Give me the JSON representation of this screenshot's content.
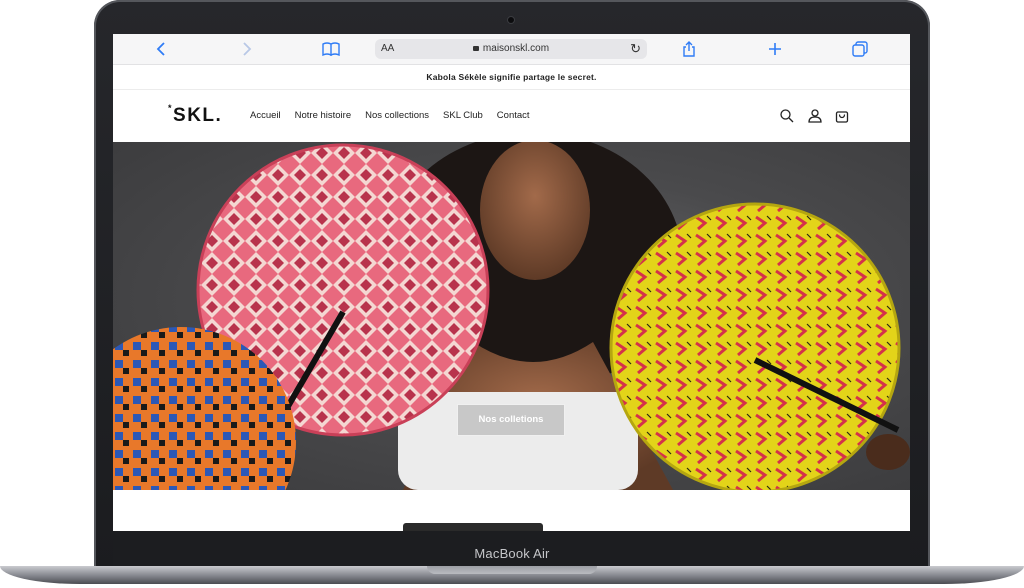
{
  "device": {
    "label": "MacBook Air"
  },
  "browser": {
    "back_icon": "chevron-left-icon",
    "forward_icon": "chevron-right-icon",
    "bookmarks_icon": "book-icon",
    "reader_label": "AA",
    "url": "maisonskl.com",
    "reload_icon": "reload-icon",
    "share_icon": "share-icon",
    "new_tab_icon": "plus-icon",
    "tabs_icon": "tabs-icon"
  },
  "announcement": "Kabola Sékèle signifie partage le secret.",
  "header": {
    "logo_star": "*",
    "logo": "SKL.",
    "nav": [
      "Accueil",
      "Notre histoire",
      "Nos collections",
      "SKL Club",
      "Contact"
    ],
    "icons": [
      "search-icon",
      "account-icon",
      "cart-icon"
    ]
  },
  "hero": {
    "cta_label": "Nos colletions"
  },
  "colors": {
    "accent": "#2f7cf6",
    "fan_pink": "#e8697e",
    "fan_yellow": "#e3d419",
    "fan_orange": "#e8782a",
    "fan_blue": "#2c58b6"
  }
}
